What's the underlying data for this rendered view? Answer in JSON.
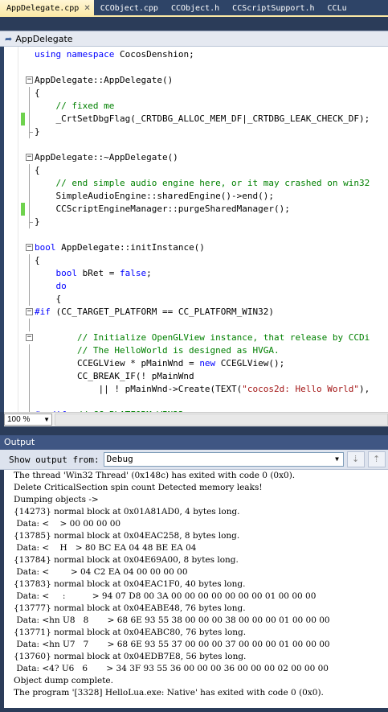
{
  "tabs": [
    {
      "label": "AppDelegate.cpp",
      "active": true
    },
    {
      "label": "CCObject.cpp",
      "active": false
    },
    {
      "label": "CCObject.h",
      "active": false
    },
    {
      "label": "CCScriptSupport.h",
      "active": false
    },
    {
      "label": "CCLu",
      "active": false
    }
  ],
  "tab_close_glyph": "✕",
  "navigation": {
    "label": "AppDelegate"
  },
  "editor": {
    "lines": [
      {
        "text": "using namespace CocosDenshion;",
        "fold": "",
        "change": false
      },
      {
        "text": "",
        "fold": "",
        "change": false
      },
      {
        "text": "AppDelegate::AppDelegate()",
        "fold": "box",
        "change": false
      },
      {
        "text": "{",
        "fold": "line",
        "change": false
      },
      {
        "text": "    // fixed me",
        "fold": "line",
        "change": false
      },
      {
        "text": "    _CrtSetDbgFlag(_CRTDBG_ALLOC_MEM_DF|_CRTDBG_LEAK_CHECK_DF);",
        "fold": "line",
        "change": true
      },
      {
        "text": "}",
        "fold": "end",
        "change": false
      },
      {
        "text": "",
        "fold": "",
        "change": false
      },
      {
        "text": "AppDelegate::~AppDelegate()",
        "fold": "box",
        "change": false
      },
      {
        "text": "{",
        "fold": "line",
        "change": false
      },
      {
        "text": "    // end simple audio engine here, or it may crashed on win32",
        "fold": "line",
        "change": false
      },
      {
        "text": "    SimpleAudioEngine::sharedEngine()->end();",
        "fold": "line",
        "change": false
      },
      {
        "text": "    CCScriptEngineManager::purgeSharedManager();",
        "fold": "line",
        "change": true
      },
      {
        "text": "}",
        "fold": "end",
        "change": false
      },
      {
        "text": "",
        "fold": "",
        "change": false
      },
      {
        "text": "bool AppDelegate::initInstance()",
        "fold": "box",
        "change": false
      },
      {
        "text": "{",
        "fold": "line",
        "change": false
      },
      {
        "text": "    bool bRet = false;",
        "fold": "line",
        "change": false
      },
      {
        "text": "    do",
        "fold": "line",
        "change": false
      },
      {
        "text": "    {",
        "fold": "line",
        "change": false
      },
      {
        "text": "#if (CC_TARGET_PLATFORM == CC_PLATFORM_WIN32)",
        "fold": "box",
        "change": false
      },
      {
        "text": "",
        "fold": "line",
        "change": false
      },
      {
        "text": "        // Initialize OpenGLView instance, that release by CCDi",
        "fold": "box",
        "change": false
      },
      {
        "text": "        // The HelloWorld is designed as HVGA.",
        "fold": "line",
        "change": false
      },
      {
        "text": "        CCEGLView * pMainWnd = new CCEGLView();",
        "fold": "line",
        "change": false
      },
      {
        "text": "        CC_BREAK_IF(! pMainWnd",
        "fold": "line",
        "change": false
      },
      {
        "text": "            || ! pMainWnd->Create(TEXT(\"cocos2d: Hello World\"),",
        "fold": "line",
        "change": false
      },
      {
        "text": "",
        "fold": "line",
        "change": false
      },
      {
        "text": "#endif  // CC_PLATFORM_WIN32",
        "fold": "line",
        "change": false
      }
    ]
  },
  "zoom": {
    "value": "100 %"
  },
  "output": {
    "title": "Output",
    "show_from_label": "Show output from:",
    "source": "Debug",
    "lines": [
      "The thread 'Win32 Thread' (0x148c) has exited with code 0 (0x0).",
      "Delete CriticalSection spin count Detected memory leaks!",
      "Dumping objects ->",
      "{14273} normal block at 0x01A81AD0, 4 bytes long.",
      " Data: <    > 00 00 00 00",
      "{13785} normal block at 0x04EAC258, 8 bytes long.",
      " Data: <    H   > 80 BC EA 04 48 BE EA 04",
      "{13784} normal block at 0x04E69A00, 8 bytes long.",
      " Data: <        > 04 C2 EA 04 00 00 00 00",
      "{13783} normal block at 0x04EAC1F0, 40 bytes long.",
      " Data: <     :          > 94 07 D8 00 3A 00 00 00 00 00 00 00 01 00 00 00",
      "{13777} normal block at 0x04EABE48, 76 bytes long.",
      " Data: <hn U8   8       > 68 6E 93 55 38 00 00 00 38 00 00 00 01 00 00 00",
      "{13771} normal block at 0x04EABC80, 76 bytes long.",
      " Data: <hn U7   7       > 68 6E 93 55 37 00 00 00 37 00 00 00 01 00 00 00",
      "{13760} normal block at 0x04EDB7E8, 56 bytes long.",
      " Data: <4? U6   6       > 34 3F 93 55 36 00 00 00 36 00 00 00 02 00 00 00",
      "Object dump complete.",
      "The program '[3328] HelloLua.exe: Native' has exited with code 0 (0x0)."
    ]
  },
  "colors": {
    "active_tab": "#fbe9a5",
    "keyword": "#0000ff",
    "comment": "#008000",
    "string": "#a31515",
    "change_marker": "#6fd24e"
  }
}
